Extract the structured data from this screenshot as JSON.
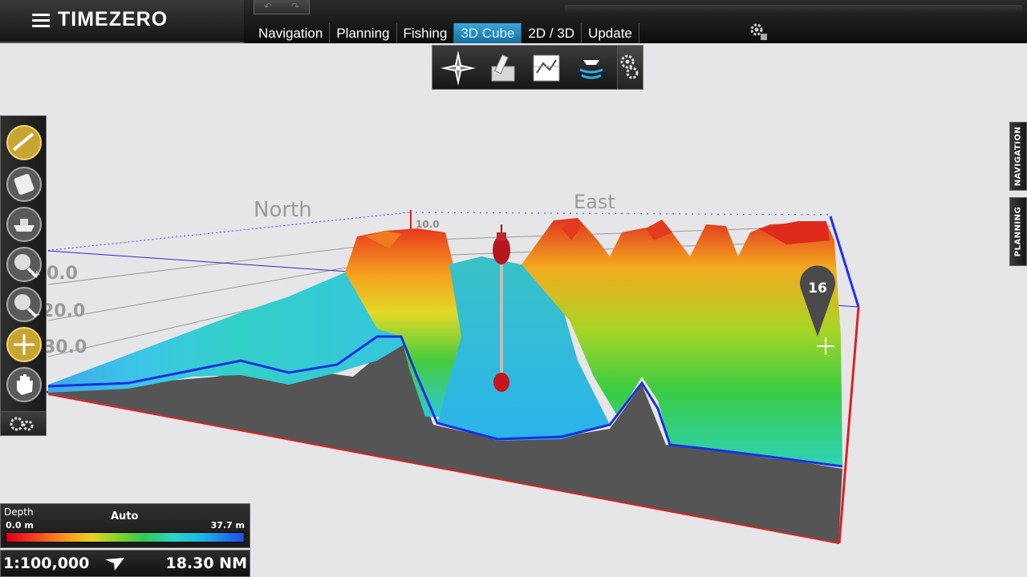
{
  "app": {
    "title": "TIMEZERO"
  },
  "toolbar": {
    "undo_label": "↶",
    "redo_label": "↷",
    "tabs": [
      {
        "label": "Navigation",
        "active": false
      },
      {
        "label": "Planning",
        "active": false
      },
      {
        "label": "Fishing",
        "active": false
      },
      {
        "label": "3D Cube",
        "active": true
      },
      {
        "label": "2D / 3D",
        "active": false
      },
      {
        "label": "Update",
        "active": false
      }
    ],
    "settings_icon": "gear-icon"
  },
  "cube_toolbar": {
    "buttons": [
      {
        "icon": "compass-rose-icon"
      },
      {
        "icon": "plotting-tool-icon"
      },
      {
        "icon": "chart-overlay-icon"
      },
      {
        "icon": "sonar-boat-icon"
      }
    ],
    "settings_icon": "gear-icon"
  },
  "left_toolbar": {
    "tools": [
      {
        "icon": "route-tool-icon",
        "active": true
      },
      {
        "icon": "device-icon"
      },
      {
        "icon": "vessel-icon"
      },
      {
        "icon": "zoom-in-icon"
      },
      {
        "icon": "zoom-out-icon"
      },
      {
        "icon": "pan-icon"
      },
      {
        "icon": "hand-icon"
      }
    ],
    "settings_icon": "gear-icon"
  },
  "side_tabs": [
    {
      "label": "NAVIGATION"
    },
    {
      "label": "PLANNING"
    }
  ],
  "scene": {
    "direction_labels": {
      "north": "North",
      "east": "East"
    },
    "depth_axis_labels": [
      "10.0",
      "0.0",
      "20.0",
      "30.0"
    ],
    "target_marker": "16"
  },
  "depth_legend": {
    "label": "Depth",
    "mode": "Auto",
    "min": "0.0 m",
    "max": "37.7 m",
    "colors": [
      "#d8001d",
      "#f7921e",
      "#e8d41e",
      "#2fca58",
      "#29d4c0",
      "#1b50e5"
    ]
  },
  "scale": {
    "ratio": "1:100,000",
    "range": "18.30 NM"
  }
}
